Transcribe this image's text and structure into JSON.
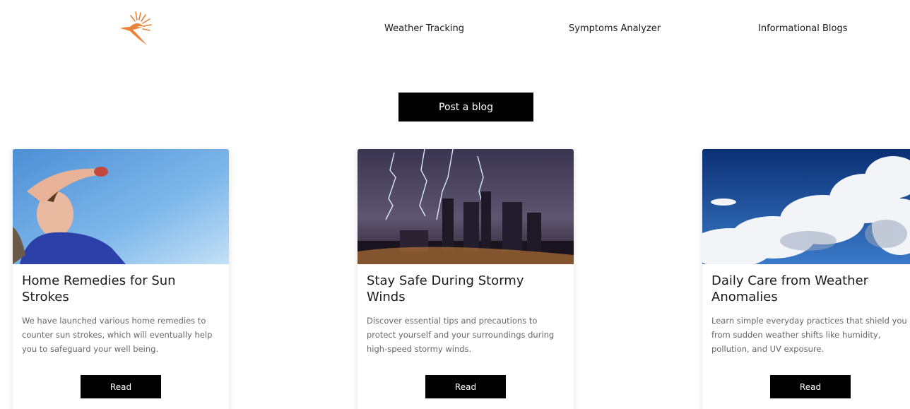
{
  "nav": {
    "links": [
      "Weather Tracking",
      "Symptoms Analyzer",
      "Informational Blogs"
    ]
  },
  "post_blog_label": "Post a blog",
  "cards": [
    {
      "title": "Home Remedies for Sun Strokes",
      "description": "We have launched various home remedies to counter sun strokes, which will eventually help you to safeguard your well being.",
      "button": "Read"
    },
    {
      "title": "Stay Safe During Stormy Winds",
      "description": "Discover essential tips and precautions to protect yourself and your surroundings during high-speed stormy winds.",
      "button": "Read"
    },
    {
      "title": "Daily Care from Weather Anomalies",
      "description": "Learn simple everyday practices that shield you from sudden weather shifts like humidity, pollution, and UV exposure.",
      "button": "Read"
    }
  ],
  "colors": {
    "logo": "#e8833a",
    "button_bg": "#000000",
    "button_text": "#ffffff",
    "description_text": "#666666"
  },
  "icons": {
    "logo": "sun-logo-icon"
  }
}
